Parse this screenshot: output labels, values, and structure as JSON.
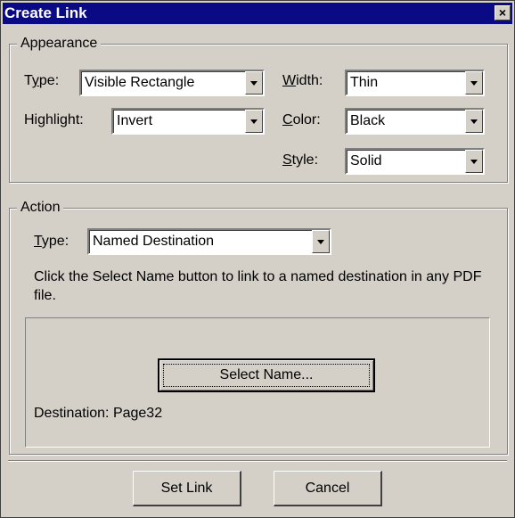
{
  "window": {
    "title": "Create Link",
    "close_symbol": "×"
  },
  "appearance": {
    "group_label": "Appearance",
    "type_label": "Type:",
    "type_value": "Visible Rectangle",
    "highlight_label": "Highlight:",
    "highlight_value": "Invert",
    "width_label": "Width:",
    "width_value": "Thin",
    "color_label": "Color:",
    "color_value": "Black",
    "style_label": "Style:",
    "style_value": "Solid"
  },
  "action": {
    "group_label": "Action",
    "type_label": "Type:",
    "type_value": "Named Destination",
    "description": "Click the Select Name button to link to a named destination in any PDF file.",
    "select_name_label": "Select Name...",
    "destination_text": "Destination: Page32"
  },
  "footer": {
    "set_link_label": "Set Link",
    "cancel_label": "Cancel"
  },
  "icons": {
    "dropdown": "chevron-down-icon",
    "close": "close-icon"
  },
  "colors": {
    "titlebar": "#0a0a84",
    "face": "#d4d0c8"
  }
}
